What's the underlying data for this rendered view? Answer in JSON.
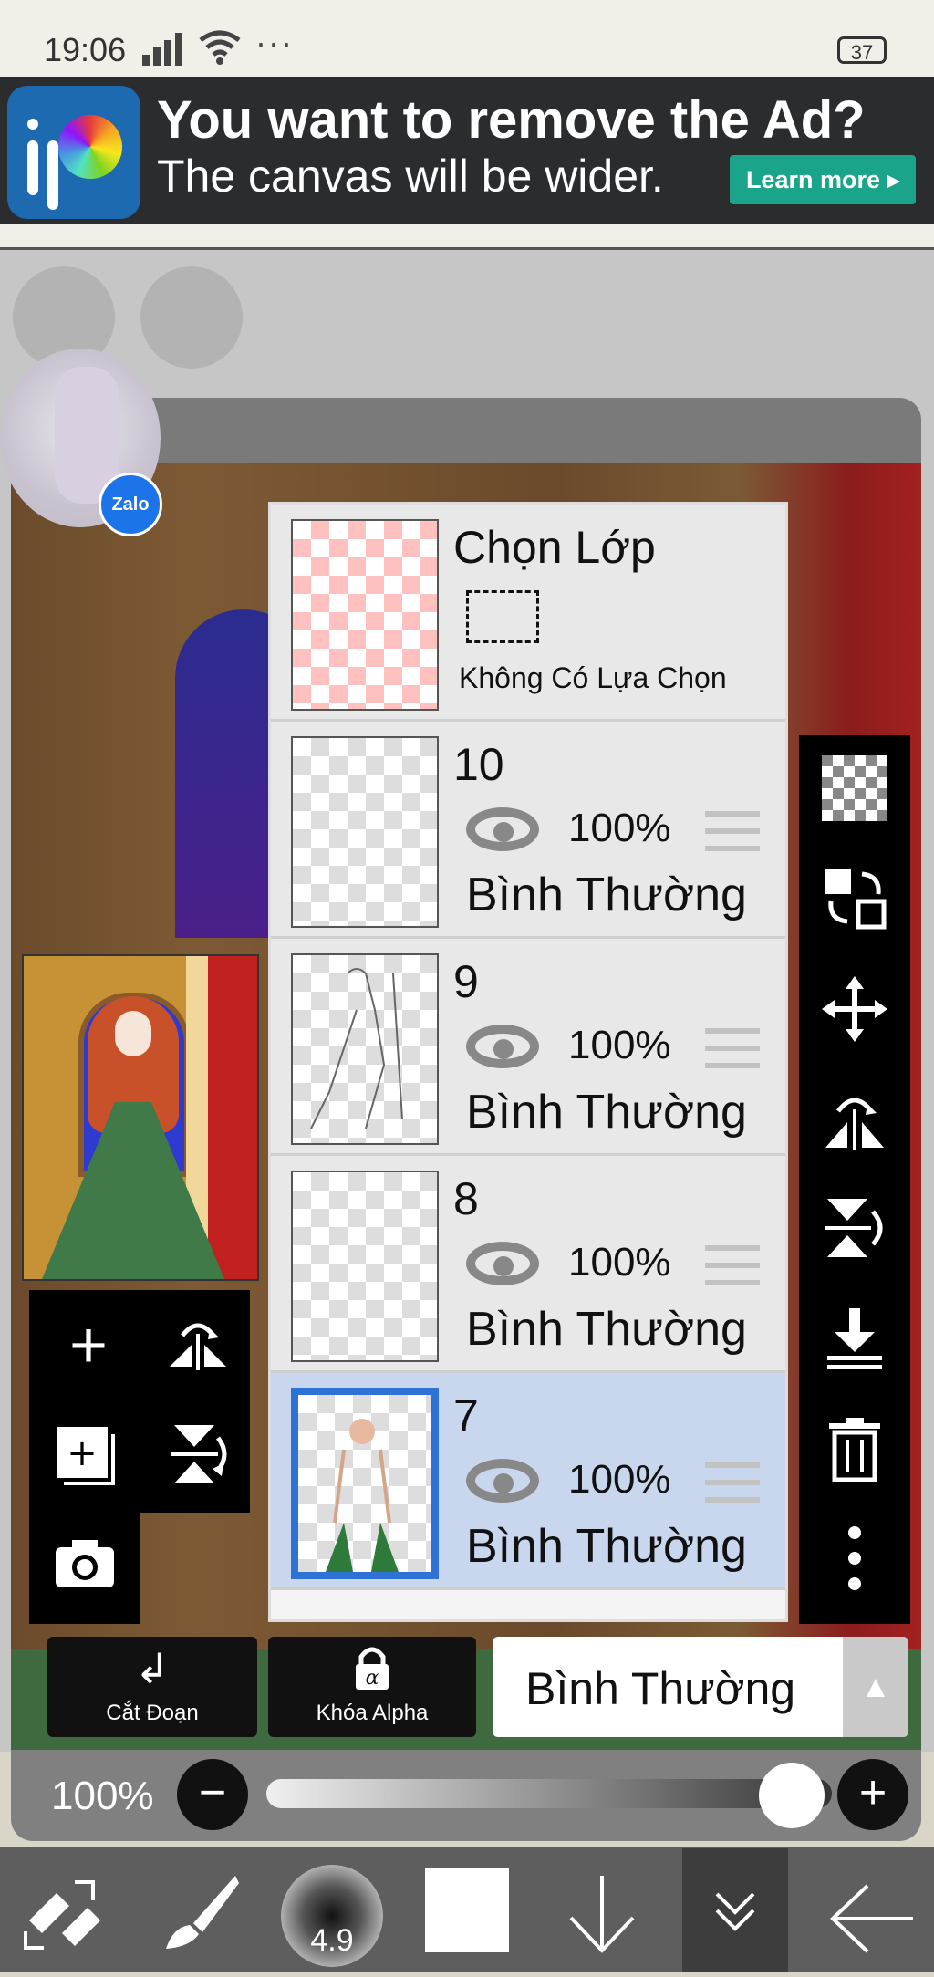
{
  "status_bar": {
    "time": "19:06",
    "signal": "📶",
    "extra": "···",
    "battery": "37"
  },
  "ad": {
    "title": "You want to remove the Ad?",
    "subtitle": "The canvas will be wider.",
    "learn_more": "Learn more ▸"
  },
  "layers": {
    "selection": {
      "title": "Chọn Lớp",
      "status": "Không Có Lựa Chọn"
    },
    "items": [
      {
        "name": "10",
        "opacity": "100%",
        "blend": "Bình Thường"
      },
      {
        "name": "9",
        "opacity": "100%",
        "blend": "Bình Thường"
      },
      {
        "name": "8",
        "opacity": "100%",
        "blend": "Bình Thường"
      },
      {
        "name": "7",
        "opacity": "100%",
        "blend": "Bình Thường"
      }
    ]
  },
  "bottom_controls": {
    "clip_label": "Cắt Đoạn",
    "alpha_label": "Khóa Alpha",
    "blend_mode": "Bình Thường"
  },
  "opacity": {
    "value": "100%",
    "level": 1.0
  },
  "brush": {
    "size": "4.9"
  },
  "icons": [
    "add-layer-icon",
    "flip-horizontal-icon",
    "copy-layer-icon",
    "flip-vertical-icon",
    "camera-icon",
    "transparency-icon",
    "swap-icon",
    "move-icon",
    "flip-icon",
    "flip-v-icon",
    "merge-down-icon",
    "trash-icon",
    "more-icon"
  ]
}
